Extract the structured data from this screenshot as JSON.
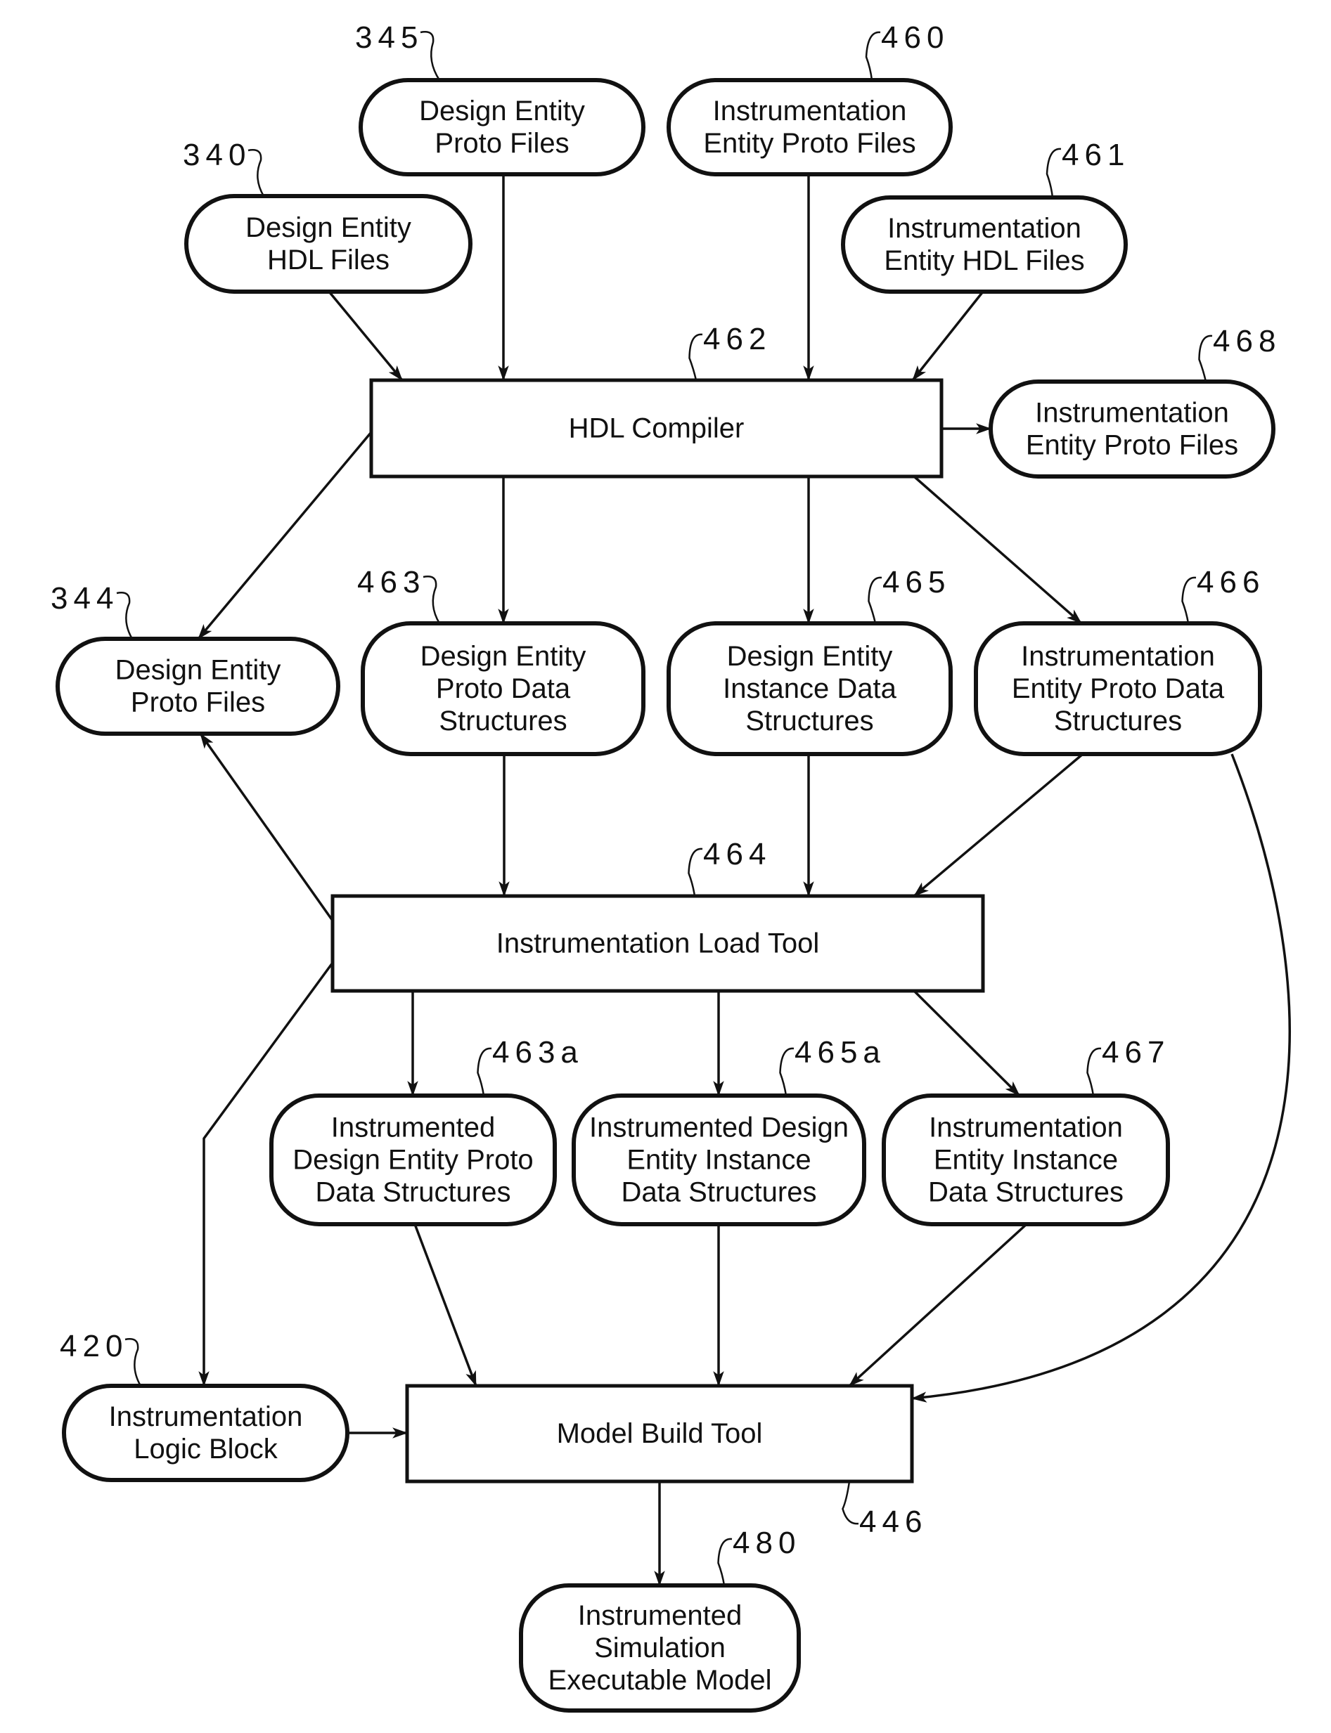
{
  "figure": {
    "nodes": [
      {
        "id": "345",
        "ref": "345",
        "shape": "rounded",
        "lines": [
          "Design Entity",
          "Proto Files"
        ]
      },
      {
        "id": "460",
        "ref": "460",
        "shape": "rounded",
        "lines": [
          "Instrumentation",
          "Entity Proto Files"
        ]
      },
      {
        "id": "340",
        "ref": "340",
        "shape": "rounded",
        "lines": [
          "Design Entity",
          "HDL Files"
        ]
      },
      {
        "id": "461",
        "ref": "461",
        "shape": "rounded",
        "lines": [
          "Instrumentation",
          "Entity HDL Files"
        ]
      },
      {
        "id": "462",
        "ref": "462",
        "shape": "rect",
        "lines": [
          "HDL Compiler"
        ]
      },
      {
        "id": "468",
        "ref": "468",
        "shape": "rounded",
        "lines": [
          "Instrumentation",
          "Entity Proto Files"
        ]
      },
      {
        "id": "344",
        "ref": "344",
        "shape": "rounded",
        "lines": [
          "Design Entity",
          "Proto Files"
        ]
      },
      {
        "id": "463",
        "ref": "463",
        "shape": "rounded",
        "lines": [
          "Design Entity",
          "Proto Data",
          "Structures"
        ]
      },
      {
        "id": "465",
        "ref": "465",
        "shape": "rounded",
        "lines": [
          "Design Entity",
          "Instance Data",
          "Structures"
        ]
      },
      {
        "id": "466",
        "ref": "466",
        "shape": "rounded",
        "lines": [
          "Instrumentation",
          "Entity Proto Data",
          "Structures"
        ]
      },
      {
        "id": "464",
        "ref": "464",
        "shape": "rect",
        "lines": [
          "Instrumentation Load Tool"
        ]
      },
      {
        "id": "463a",
        "ref": "463a",
        "shape": "rounded",
        "lines": [
          "Instrumented",
          "Design Entity Proto",
          "Data Structures"
        ]
      },
      {
        "id": "465a",
        "ref": "465a",
        "shape": "rounded",
        "lines": [
          "Instrumented Design",
          "Entity Instance",
          "Data Structures"
        ]
      },
      {
        "id": "467",
        "ref": "467",
        "shape": "rounded",
        "lines": [
          "Instrumentation",
          "Entity Instance",
          "Data Structures"
        ]
      },
      {
        "id": "420",
        "ref": "420",
        "shape": "rounded",
        "lines": [
          "Instrumentation",
          "Logic Block"
        ]
      },
      {
        "id": "446",
        "ref": "446",
        "shape": "rect",
        "lines": [
          "Model Build Tool"
        ]
      },
      {
        "id": "480",
        "ref": "480",
        "shape": "rounded",
        "lines": [
          "Instrumented",
          "Simulation",
          "Executable Model"
        ]
      }
    ],
    "edges": [
      {
        "from": "340",
        "to": "462"
      },
      {
        "from": "345",
        "to": "462"
      },
      {
        "from": "460",
        "to": "462"
      },
      {
        "from": "461",
        "to": "462"
      },
      {
        "from": "462",
        "to": "468"
      },
      {
        "from": "462",
        "to": "344"
      },
      {
        "from": "462",
        "to": "463"
      },
      {
        "from": "462",
        "to": "465"
      },
      {
        "from": "462",
        "to": "466"
      },
      {
        "from": "463",
        "to": "464"
      },
      {
        "from": "465",
        "to": "464"
      },
      {
        "from": "466",
        "to": "464"
      },
      {
        "from": "464",
        "to": "344"
      },
      {
        "from": "464",
        "to": "420"
      },
      {
        "from": "464",
        "to": "463a"
      },
      {
        "from": "464",
        "to": "465a"
      },
      {
        "from": "464",
        "to": "467"
      },
      {
        "from": "463a",
        "to": "446"
      },
      {
        "from": "465a",
        "to": "446"
      },
      {
        "from": "467",
        "to": "446"
      },
      {
        "from": "466",
        "to": "446"
      },
      {
        "from": "420",
        "to": "446"
      },
      {
        "from": "446",
        "to": "480"
      }
    ]
  }
}
